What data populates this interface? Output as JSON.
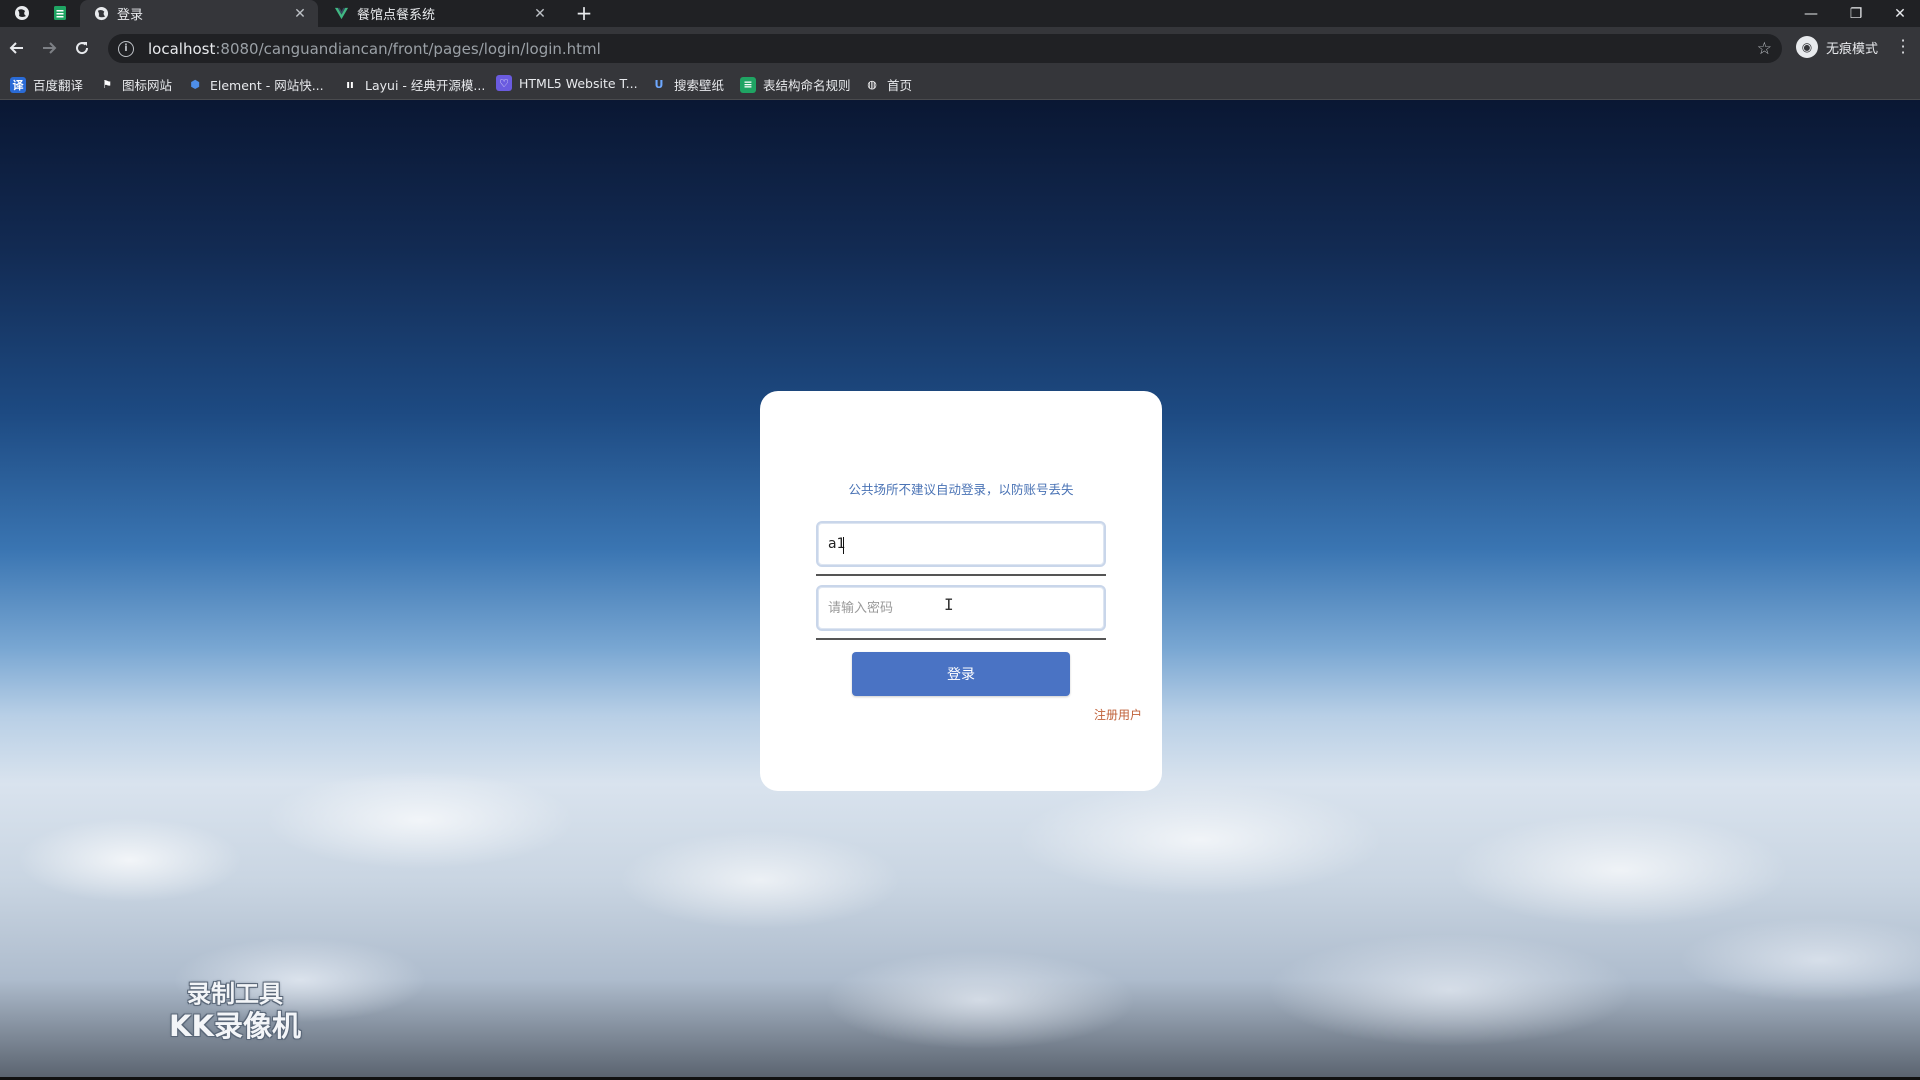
{
  "browser": {
    "tabs": [
      {
        "label": "登录",
        "active": true
      },
      {
        "label": "餐馆点餐系统",
        "active": false
      }
    ],
    "new_tab": "+",
    "window_controls": {
      "minimize": "—",
      "restore": "❐",
      "close": "✕"
    },
    "url": {
      "host": "localhost",
      "rest": ":8080/canguandiancan/front/pages/login/login.html"
    },
    "incognito_label": "无痕模式"
  },
  "bookmarks": [
    {
      "label": "百度翻译",
      "icon": "translate-icon",
      "color": "#2a6bd6",
      "glyph": "译"
    },
    {
      "label": "图标网站",
      "icon": "flag-icon",
      "color": "#35363a",
      "glyph": "⚑"
    },
    {
      "label": "Element - 网站快...",
      "icon": "element-icon",
      "color": "#4e8ee8",
      "glyph": "⬢"
    },
    {
      "label": "Layui - 经典开源模...",
      "icon": "layui-icon",
      "color": "#35363a",
      "glyph": "ıı"
    },
    {
      "label": "HTML5 Website T...",
      "icon": "html5-template-icon",
      "color": "#6a5be0",
      "glyph": "♡"
    },
    {
      "label": "搜索壁纸",
      "icon": "wallpaper-icon",
      "color": "#35363a",
      "glyph": "U"
    },
    {
      "label": "表结构命名规则",
      "icon": "sheet-icon",
      "color": "#1fa463",
      "glyph": "≡"
    },
    {
      "label": "首页",
      "icon": "globe-icon",
      "color": "#35363a",
      "glyph": "◍"
    }
  ],
  "login": {
    "notice": "公共场所不建议自动登录，以防账号丢失",
    "username_value": "a1",
    "password_placeholder": "请输入密码",
    "login_button": "登录",
    "register_link": "注册用户"
  },
  "watermark": {
    "line1": "录制工具",
    "line2": "KK录像机"
  },
  "colors": {
    "button": "#4a73c4",
    "notice_text": "#4a73b5",
    "register_link": "#c0623a"
  }
}
